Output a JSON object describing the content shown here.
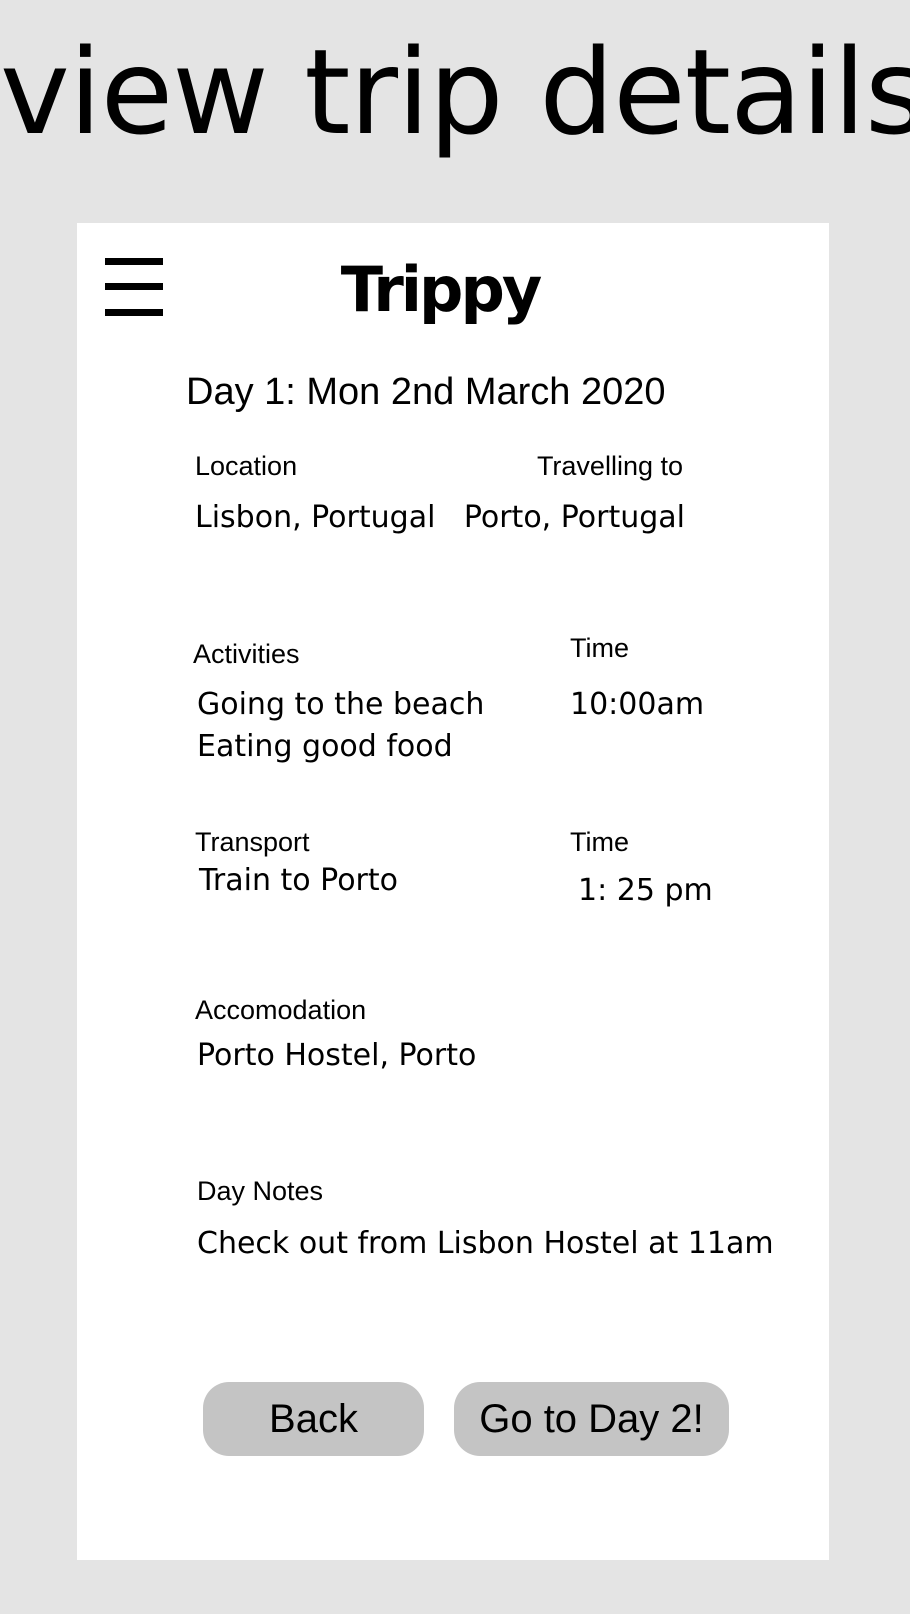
{
  "page": {
    "heading": "view trip details"
  },
  "header": {
    "app_title": "Trippy",
    "menu_icon": "hamburger-menu-icon"
  },
  "day": {
    "title": "Day 1: Mon 2nd March 2020",
    "location": {
      "label": "Location",
      "value": "Lisbon, Portugal"
    },
    "travelling_to": {
      "label": "Travelling to",
      "value": "Porto, Portugal"
    },
    "activities": {
      "label": "Activities",
      "items": [
        "Going to the beach",
        "Eating good food"
      ],
      "time_label": "Time",
      "time_value": "10:00am"
    },
    "transport": {
      "label": "Transport",
      "value": "Train to Porto",
      "time_label": "Time",
      "time_value": "1: 25 pm"
    },
    "accommodation": {
      "label": "Accomodation",
      "value": "Porto Hostel, Porto"
    },
    "notes": {
      "label": "Day Notes",
      "value": "Check out from Lisbon Hostel at 11am"
    }
  },
  "actions": {
    "back_label": "Back",
    "next_label": "Go to Day 2!"
  },
  "colors": {
    "page_background": "#e4e4e4",
    "card_background": "#ffffff",
    "button_background": "#c4c4c4",
    "text": "#000000"
  }
}
